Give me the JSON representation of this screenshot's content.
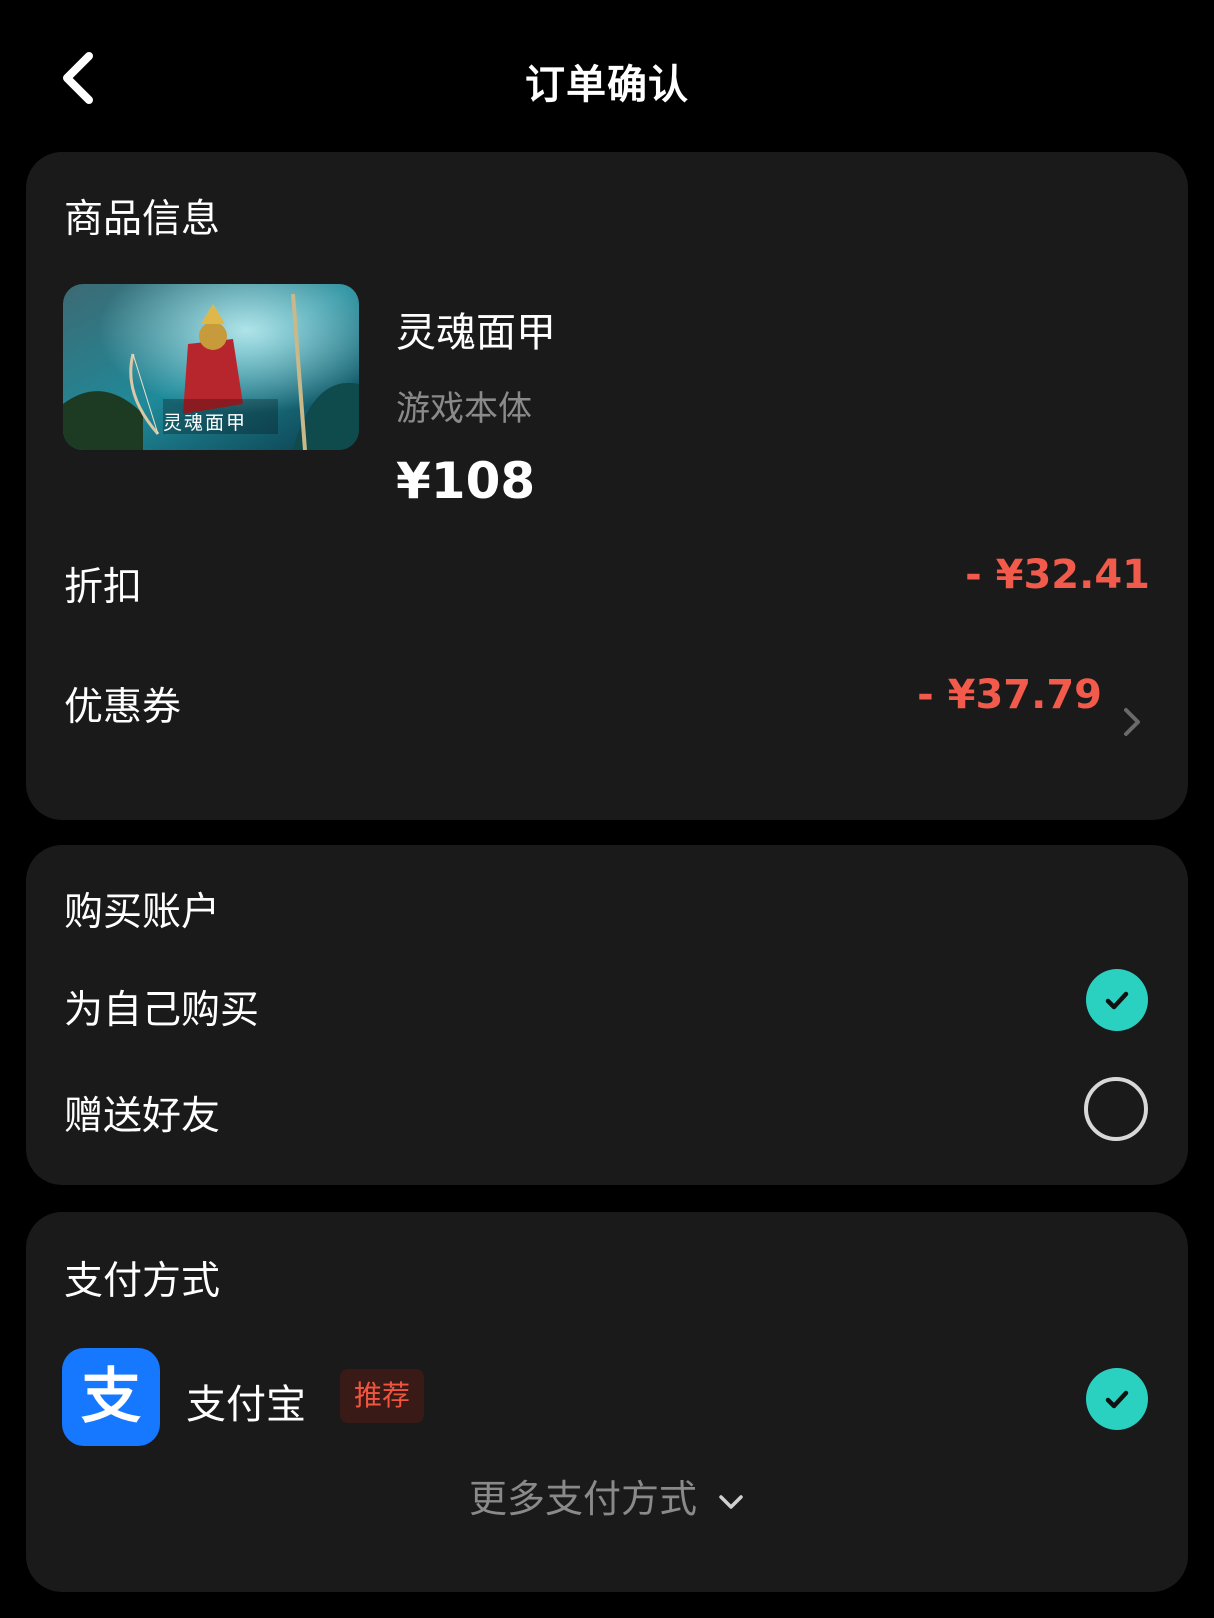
{
  "header": {
    "title": "订单确认"
  },
  "product_card": {
    "section_title": "商品信息",
    "product": {
      "name": "灵魂面甲",
      "subtitle": "游戏本体",
      "price": "¥108",
      "image_caption": "灵魂面甲"
    },
    "discount": {
      "label": "折扣",
      "value": "- ¥32.41"
    },
    "coupon": {
      "label": "优惠券",
      "value": "- ¥37.79"
    }
  },
  "account_card": {
    "section_title": "购买账户",
    "options": [
      {
        "label": "为自己购买",
        "selected": true
      },
      {
        "label": "赠送好友",
        "selected": false
      }
    ]
  },
  "payment_card": {
    "section_title": "支付方式",
    "method": {
      "name": "支付宝",
      "badge": "推荐",
      "icon_glyph": "支",
      "selected": true
    },
    "more_label": "更多支付方式"
  },
  "colors": {
    "accent_teal": "#2ad1c1",
    "price_red": "#f25a4b",
    "card_bg": "#1a1a1a",
    "alipay_blue": "#1677ff"
  }
}
